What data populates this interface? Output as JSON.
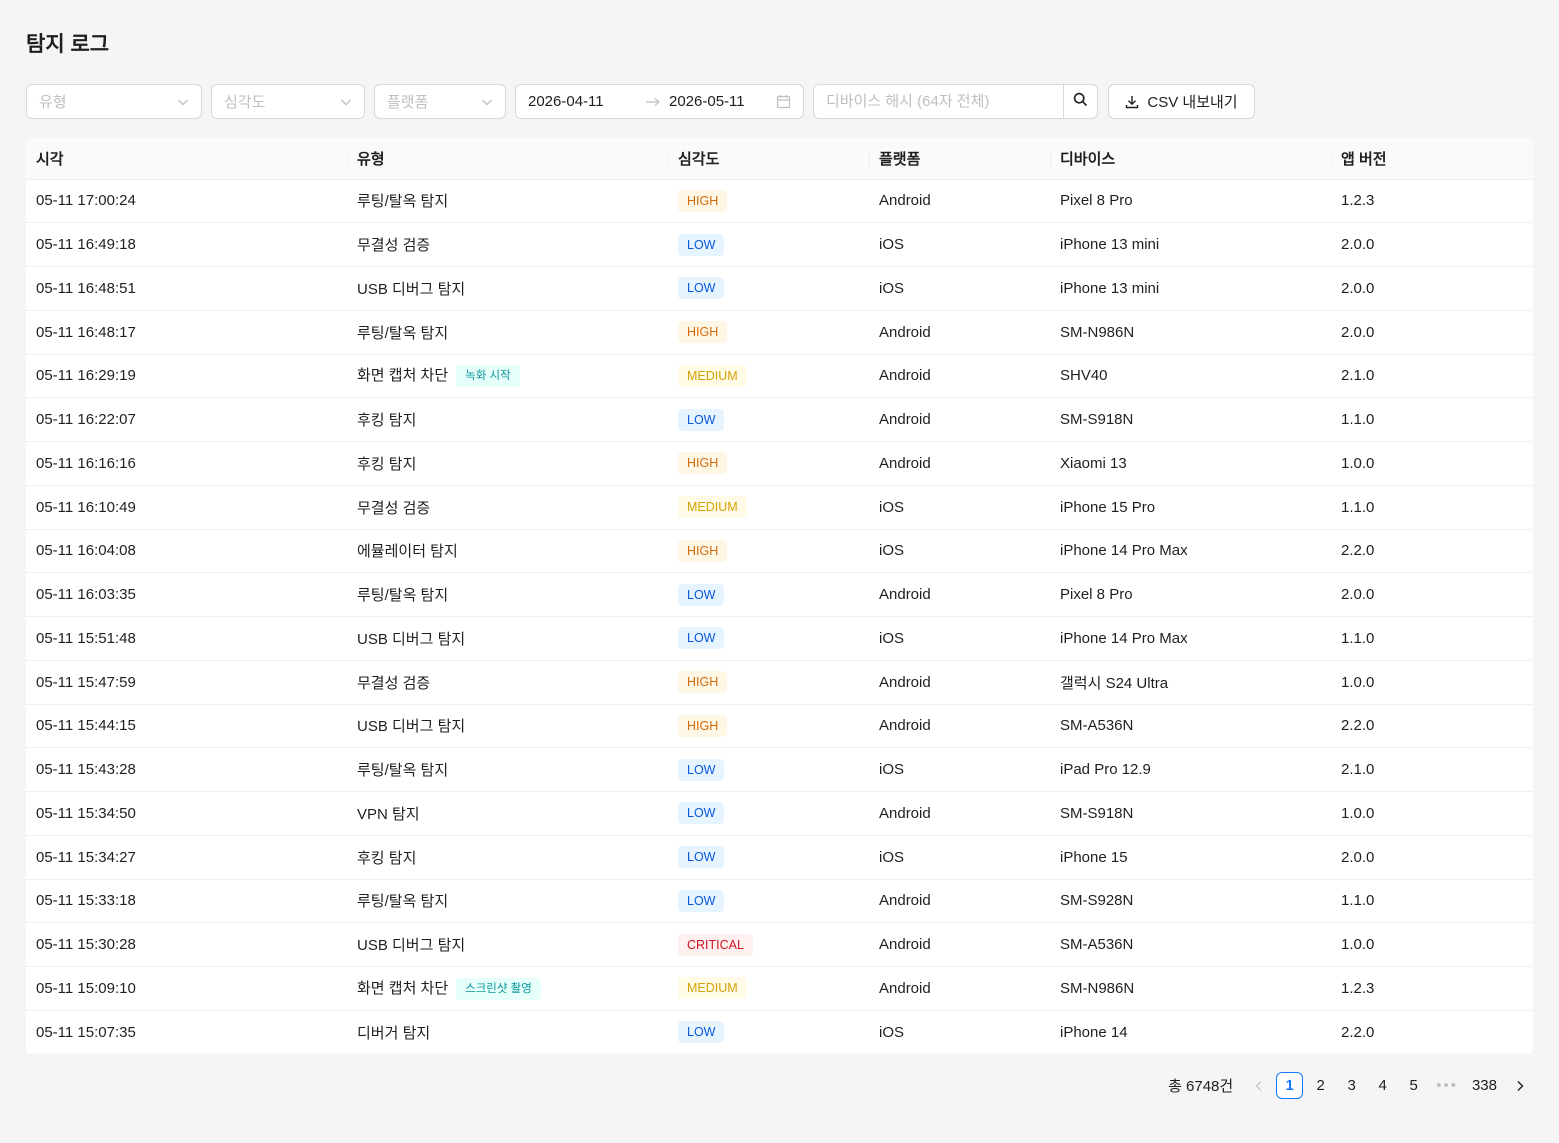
{
  "page": {
    "title": "탐지 로그"
  },
  "filters": {
    "type_placeholder": "유형",
    "severity_placeholder": "심각도",
    "platform_placeholder": "플랫폼",
    "date_start": "2026-04-11",
    "date_end": "2026-05-11",
    "search_placeholder": "디바이스 해시 (64자 전체)",
    "csv_label": "CSV 내보내기"
  },
  "table": {
    "columns": [
      "시각",
      "유형",
      "심각도",
      "플랫폼",
      "디바이스",
      "앱 버전"
    ],
    "rows": [
      {
        "time": "05-11 17:00:24",
        "type": "루팅/탈옥 탐지",
        "sub": "",
        "severity": "HIGH",
        "platform": "Android",
        "device": "Pixel 8 Pro",
        "version": "1.2.3"
      },
      {
        "time": "05-11 16:49:18",
        "type": "무결성 검증",
        "sub": "",
        "severity": "LOW",
        "platform": "iOS",
        "device": "iPhone 13 mini",
        "version": "2.0.0"
      },
      {
        "time": "05-11 16:48:51",
        "type": "USB 디버그 탐지",
        "sub": "",
        "severity": "LOW",
        "platform": "iOS",
        "device": "iPhone 13 mini",
        "version": "2.0.0"
      },
      {
        "time": "05-11 16:48:17",
        "type": "루팅/탈옥 탐지",
        "sub": "",
        "severity": "HIGH",
        "platform": "Android",
        "device": "SM-N986N",
        "version": "2.0.0"
      },
      {
        "time": "05-11 16:29:19",
        "type": "화면 캡처 차단",
        "sub": "녹화 시작",
        "severity": "MEDIUM",
        "platform": "Android",
        "device": "SHV40",
        "version": "2.1.0"
      },
      {
        "time": "05-11 16:22:07",
        "type": "후킹 탐지",
        "sub": "",
        "severity": "LOW",
        "platform": "Android",
        "device": "SM-S918N",
        "version": "1.1.0"
      },
      {
        "time": "05-11 16:16:16",
        "type": "후킹 탐지",
        "sub": "",
        "severity": "HIGH",
        "platform": "Android",
        "device": "Xiaomi 13",
        "version": "1.0.0"
      },
      {
        "time": "05-11 16:10:49",
        "type": "무결성 검증",
        "sub": "",
        "severity": "MEDIUM",
        "platform": "iOS",
        "device": "iPhone 15 Pro",
        "version": "1.1.0"
      },
      {
        "time": "05-11 16:04:08",
        "type": "에뮬레이터 탐지",
        "sub": "",
        "severity": "HIGH",
        "platform": "iOS",
        "device": "iPhone 14 Pro Max",
        "version": "2.2.0"
      },
      {
        "time": "05-11 16:03:35",
        "type": "루팅/탈옥 탐지",
        "sub": "",
        "severity": "LOW",
        "platform": "Android",
        "device": "Pixel 8 Pro",
        "version": "2.0.0"
      },
      {
        "time": "05-11 15:51:48",
        "type": "USB 디버그 탐지",
        "sub": "",
        "severity": "LOW",
        "platform": "iOS",
        "device": "iPhone 14 Pro Max",
        "version": "1.1.0"
      },
      {
        "time": "05-11 15:47:59",
        "type": "무결성 검증",
        "sub": "",
        "severity": "HIGH",
        "platform": "Android",
        "device": "갤럭시 S24 Ultra",
        "version": "1.0.0"
      },
      {
        "time": "05-11 15:44:15",
        "type": "USB 디버그 탐지",
        "sub": "",
        "severity": "HIGH",
        "platform": "Android",
        "device": "SM-A536N",
        "version": "2.2.0"
      },
      {
        "time": "05-11 15:43:28",
        "type": "루팅/탈옥 탐지",
        "sub": "",
        "severity": "LOW",
        "platform": "iOS",
        "device": "iPad Pro 12.9",
        "version": "2.1.0"
      },
      {
        "time": "05-11 15:34:50",
        "type": "VPN 탐지",
        "sub": "",
        "severity": "LOW",
        "platform": "Android",
        "device": "SM-S918N",
        "version": "1.0.0"
      },
      {
        "time": "05-11 15:34:27",
        "type": "후킹 탐지",
        "sub": "",
        "severity": "LOW",
        "platform": "iOS",
        "device": "iPhone 15",
        "version": "2.0.0"
      },
      {
        "time": "05-11 15:33:18",
        "type": "루팅/탈옥 탐지",
        "sub": "",
        "severity": "LOW",
        "platform": "Android",
        "device": "SM-S928N",
        "version": "1.1.0"
      },
      {
        "time": "05-11 15:30:28",
        "type": "USB 디버그 탐지",
        "sub": "",
        "severity": "CRITICAL",
        "platform": "Android",
        "device": "SM-A536N",
        "version": "1.0.0"
      },
      {
        "time": "05-11 15:09:10",
        "type": "화면 캡처 차단",
        "sub": "스크린샷 촬영",
        "severity": "MEDIUM",
        "platform": "Android",
        "device": "SM-N986N",
        "version": "1.2.3"
      },
      {
        "time": "05-11 15:07:35",
        "type": "디버거 탐지",
        "sub": "",
        "severity": "LOW",
        "platform": "iOS",
        "device": "iPhone 14",
        "version": "2.2.0"
      }
    ]
  },
  "pagination": {
    "total_text": "총 6748건",
    "pages": [
      "1",
      "2",
      "3",
      "4",
      "5"
    ],
    "current": "1",
    "ellipsis": "•••",
    "last": "338"
  }
}
